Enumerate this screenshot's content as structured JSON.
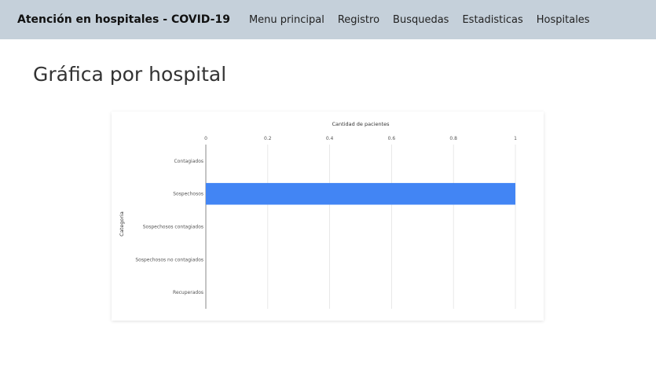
{
  "navbar": {
    "brand": "Atención en hospitales - COVID-19",
    "links": [
      "Menu principal",
      "Registro",
      "Busquedas",
      "Estadisticas",
      "Hospitales"
    ]
  },
  "page": {
    "title": "Gráfica por hospital"
  },
  "colors": {
    "navbar_bg": "#c5d0da",
    "bar": "#4285f4"
  },
  "chart_data": {
    "type": "bar",
    "orientation": "horizontal",
    "xlabel": "Cantidad de pacientes",
    "ylabel": "Categoria",
    "xlim": [
      0,
      1
    ],
    "xticks": [
      "0",
      "0.2",
      "0.4",
      "0.6",
      "0.8",
      "1"
    ],
    "categories": [
      "Contagiados",
      "Sospechosos",
      "Sospechosos contagiados",
      "Sospechosos no contagiados",
      "Recuperados"
    ],
    "values": [
      0,
      1,
      0,
      0,
      0
    ],
    "grid": true
  }
}
